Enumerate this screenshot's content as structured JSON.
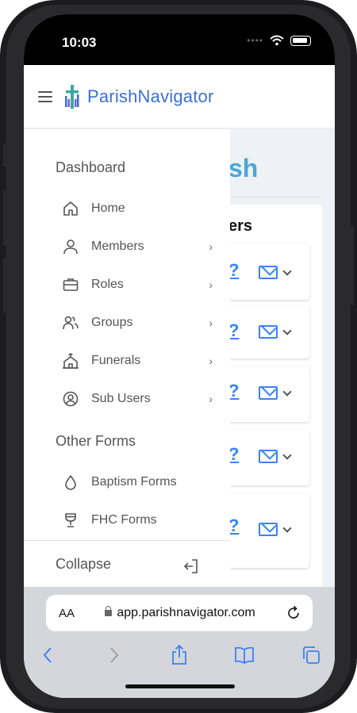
{
  "status_bar": {
    "time": "10:03"
  },
  "app": {
    "brand": "ParishNavigator"
  },
  "background_page": {
    "title_fragment": "sh",
    "section_fragment": "ers"
  },
  "drawer": {
    "section1": "Dashboard",
    "items": [
      {
        "label": "Home",
        "icon": "home-icon",
        "chevron": false
      },
      {
        "label": "Members",
        "icon": "user-icon",
        "chevron": true
      },
      {
        "label": "Roles",
        "icon": "briefcase-icon",
        "chevron": true
      },
      {
        "label": "Groups",
        "icon": "users-icon",
        "chevron": true
      },
      {
        "label": "Funerals",
        "icon": "church-icon",
        "chevron": true
      },
      {
        "label": "Sub Users",
        "icon": "user-circle-icon",
        "chevron": true
      }
    ],
    "section2": "Other Forms",
    "forms": [
      {
        "label": "Baptism Forms",
        "icon": "drop-icon"
      },
      {
        "label": "FHC Forms",
        "icon": "chalice-icon"
      }
    ],
    "collapse": "Collapse"
  },
  "browser": {
    "aa_label": "AA",
    "url": "app.parishnavigator.com"
  },
  "colors": {
    "brand": "#3b6fd8",
    "accent": "#3b82f6",
    "title": "#4aa8d8"
  }
}
